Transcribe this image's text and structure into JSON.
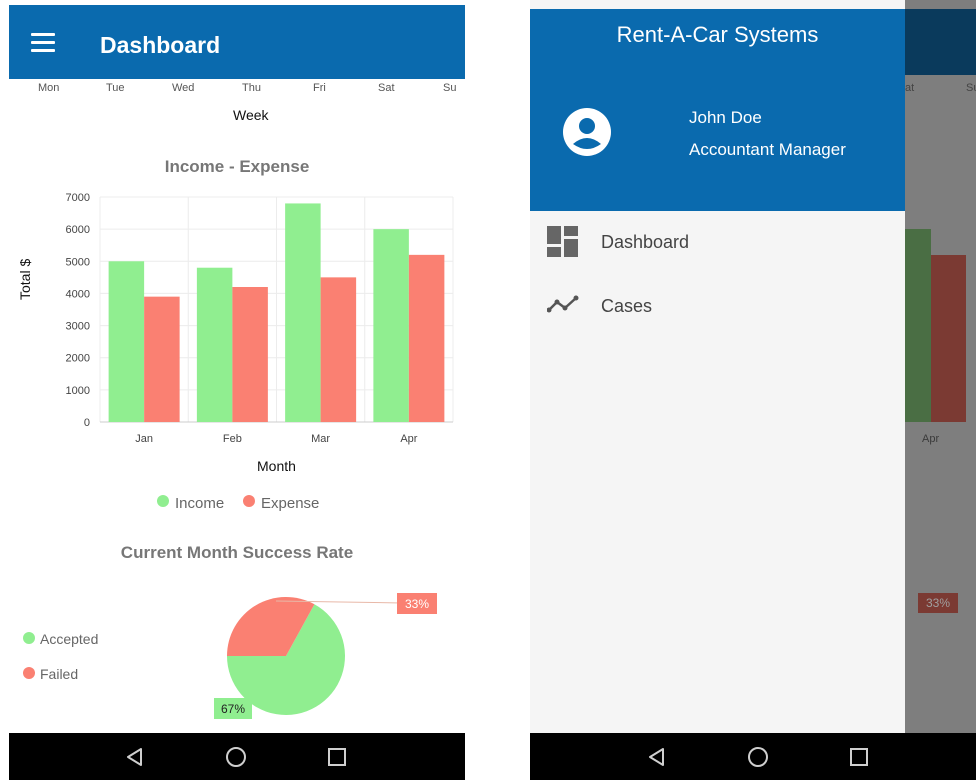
{
  "left": {
    "appbar": {
      "title": "Dashboard"
    },
    "week_chart": {
      "days": [
        "Mon",
        "Tue",
        "Wed",
        "Thu",
        "Fri",
        "Sat",
        "Su"
      ],
      "xlabel": "Week"
    },
    "income_chart": {
      "title": "Income - Expense",
      "ylabel": "Total $",
      "xlabel": "Month",
      "yticks": [
        "7000",
        "6000",
        "5000",
        "4000",
        "3000",
        "2000",
        "1000",
        "0"
      ],
      "legend": [
        "Income",
        "Expense"
      ]
    },
    "success_chart": {
      "title": "Current Month Success Rate",
      "legend": [
        "Accepted",
        "Failed"
      ],
      "label_failed": "33%",
      "label_accepted": "67%"
    }
  },
  "right": {
    "drawer": {
      "app_title": "Rent-A-Car Systems",
      "user_name": "John Doe",
      "user_role": "Accountant Manager",
      "items": [
        {
          "label": "Dashboard",
          "icon": "dashboard-icon"
        },
        {
          "label": "Cases",
          "icon": "trending-icon"
        }
      ]
    },
    "background": {
      "days_partial": [
        "at",
        "Su"
      ],
      "month_partial": "Apr",
      "pie_label_partial": "33%"
    }
  },
  "colors": {
    "primary": "#0a6aae",
    "income": "#90ee90",
    "expense": "#fa8072",
    "navbar": "#000000"
  },
  "chart_data": [
    {
      "type": "bar",
      "title": "Income - Expense",
      "xlabel": "Month",
      "ylabel": "Total $",
      "categories": [
        "Jan",
        "Feb",
        "Mar",
        "Apr"
      ],
      "series": [
        {
          "name": "Income",
          "values": [
            5000,
            4800,
            6800,
            6000
          ]
        },
        {
          "name": "Expense",
          "values": [
            3900,
            4200,
            4500,
            5200
          ]
        }
      ],
      "ylim": [
        0,
        7000
      ],
      "grid": true,
      "legend": "bottom"
    },
    {
      "type": "pie",
      "title": "Current Month Success Rate",
      "labels": [
        "Accepted",
        "Failed"
      ],
      "values": [
        67,
        33
      ],
      "legend": "left"
    }
  ]
}
